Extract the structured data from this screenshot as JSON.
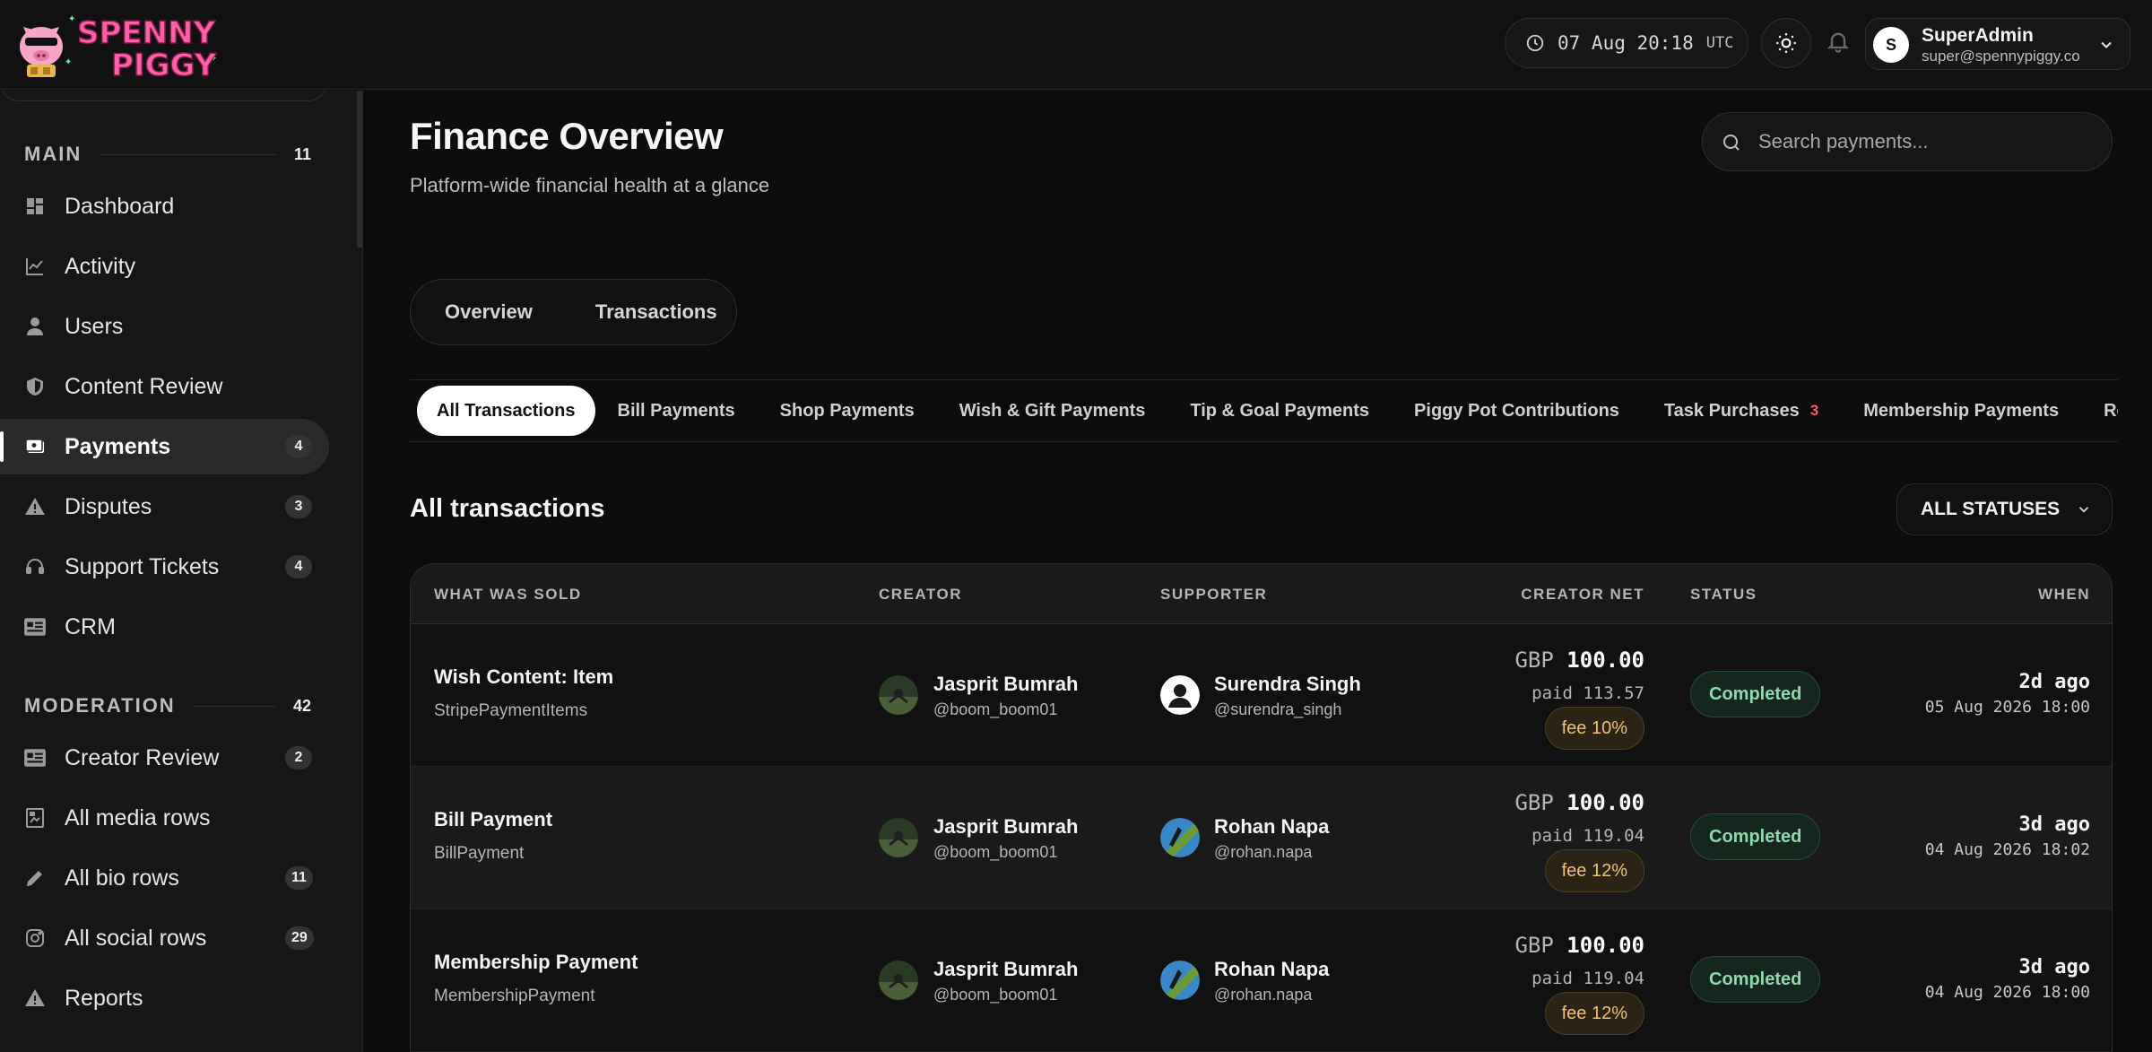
{
  "header": {
    "logo_text": "SPENNY PIGGY",
    "clock_time": "07 Aug 20:18",
    "clock_zone": "UTC",
    "user": {
      "initial": "S",
      "name": "SuperAdmin",
      "email": "super@spennypiggy.co"
    }
  },
  "sidebar": {
    "sections": [
      {
        "title": "MAIN",
        "count": "11"
      },
      {
        "title": "MODERATION",
        "count": "42"
      }
    ],
    "items": [
      {
        "label": "Dashboard",
        "icon": "dashboard-icon",
        "badge": ""
      },
      {
        "label": "Activity",
        "icon": "chart-line-icon",
        "badge": ""
      },
      {
        "label": "Users",
        "icon": "user-icon",
        "badge": ""
      },
      {
        "label": "Content Review",
        "icon": "shield-icon",
        "badge": ""
      },
      {
        "label": "Payments",
        "icon": "payments-icon",
        "badge": "4",
        "active": true
      },
      {
        "label": "Disputes",
        "icon": "warning-icon",
        "badge": "3"
      },
      {
        "label": "Support Tickets",
        "icon": "headset-icon",
        "badge": "4"
      },
      {
        "label": "CRM",
        "icon": "id-card-icon",
        "badge": ""
      },
      {
        "label": "Creator Review",
        "icon": "id-card-icon",
        "badge": "2"
      },
      {
        "label": "All media rows",
        "icon": "media-icon",
        "badge": ""
      },
      {
        "label": "All bio rows",
        "icon": "pencil-icon",
        "badge": "11"
      },
      {
        "label": "All social rows",
        "icon": "instagram-icon",
        "badge": "29"
      },
      {
        "label": "Reports",
        "icon": "warning-icon",
        "badge": ""
      }
    ]
  },
  "main": {
    "title": "Finance Overview",
    "subtitle": "Platform-wide financial health at a glance",
    "search_placeholder": "Search payments...",
    "view_tabs": [
      "Overview",
      "Transactions"
    ],
    "filter_tabs": [
      {
        "label": "All Transactions",
        "active": true,
        "count": ""
      },
      {
        "label": "Bill Payments",
        "count": ""
      },
      {
        "label": "Shop Payments",
        "count": ""
      },
      {
        "label": "Wish & Gift Payments",
        "count": ""
      },
      {
        "label": "Tip & Goal Payments",
        "count": ""
      },
      {
        "label": "Piggy Pot Contributions",
        "count": ""
      },
      {
        "label": "Task Purchases",
        "count": "3"
      },
      {
        "label": "Membership Payments",
        "count": ""
      },
      {
        "label": "Referral",
        "count": ""
      }
    ],
    "section_title": "All transactions",
    "status_filter": "ALL STATUSES",
    "table": {
      "columns": [
        "WHAT WAS SOLD",
        "CREATOR",
        "SUPPORTER",
        "CREATOR NET",
        "STATUS",
        "WHEN"
      ],
      "rows": [
        {
          "title": "Wish Content: Item",
          "type": "StripePaymentItems",
          "creator_name": "Jasprit Bumrah",
          "creator_handle": "@boom_boom01",
          "supporter_name": "Surendra Singh",
          "supporter_handle": "@surendra_singh",
          "currency": "GBP",
          "net": "100.00",
          "paid": "paid 113.57",
          "fee": "fee 10%",
          "status": "Completed",
          "when_rel": "2d ago",
          "when_abs": "05 Aug 2026 18:00"
        },
        {
          "title": "Bill Payment",
          "type": "BillPayment",
          "creator_name": "Jasprit Bumrah",
          "creator_handle": "@boom_boom01",
          "supporter_name": "Rohan Napa",
          "supporter_handle": "@rohan.napa",
          "currency": "GBP",
          "net": "100.00",
          "paid": "paid 119.04",
          "fee": "fee 12%",
          "status": "Completed",
          "when_rel": "3d ago",
          "when_abs": "04 Aug 2026 18:02"
        },
        {
          "title": "Membership Payment",
          "type": "MembershipPayment",
          "creator_name": "Jasprit Bumrah",
          "creator_handle": "@boom_boom01",
          "supporter_name": "Rohan Napa",
          "supporter_handle": "@rohan.napa",
          "currency": "GBP",
          "net": "100.00",
          "paid": "paid 119.04",
          "fee": "fee 12%",
          "status": "Completed",
          "when_rel": "3d ago",
          "when_abs": "04 Aug 2026 18:00"
        }
      ]
    }
  },
  "colors": {
    "background": "#0c0c0c",
    "panel": "#161616",
    "accent_pink": "#ff5fa8",
    "status_green": "#8fd9ae",
    "fee_amber": "#f0c274",
    "count_red": "#ff5a5a"
  }
}
